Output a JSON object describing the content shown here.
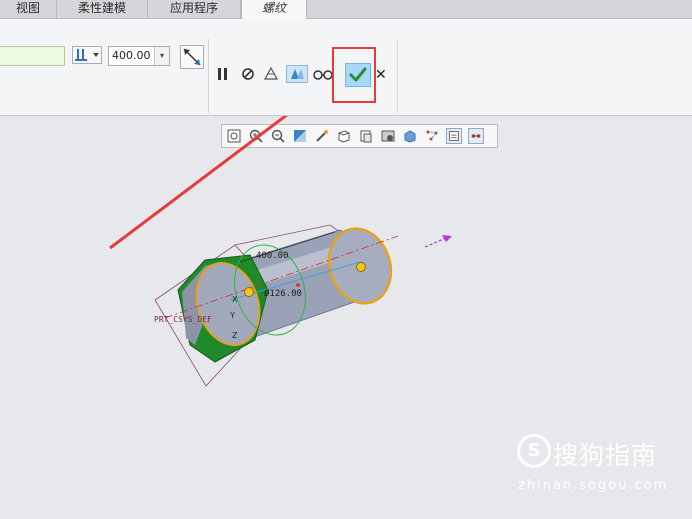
{
  "tabs": [
    {
      "label": "视图"
    },
    {
      "label": "柔性建模"
    },
    {
      "label": "应用程序"
    },
    {
      "label": "螺纹",
      "active": true
    }
  ],
  "ribbon": {
    "depth_value": "400.00",
    "depth_options_arrow": "▾",
    "tools": {
      "pause": "pause-icon",
      "no_preview": "no-preview-icon",
      "preview": "preview-icon",
      "verify": "verify-icon",
      "glasses": "glasses-icon"
    },
    "ok": "check-icon",
    "cancel": "✕"
  },
  "model": {
    "dim_length": "400.00",
    "dim_diameter": "Ø126.00",
    "csys_label": "PRT_CSYS_DEF",
    "axis_x": "X",
    "axis_y": "Y",
    "axis_z": "Z"
  },
  "watermark": {
    "brand": "搜狗指南",
    "url": "zhinan.sogou.com",
    "logo_letter": "S"
  },
  "colors": {
    "highlight_red": "#e8393b",
    "ok_blue": "#a6d9f7",
    "check_green": "#2a8a3a",
    "cylinder": "#9aa2b8",
    "hex_face": "#1e8a2a",
    "edge_orange": "#e6a21a"
  }
}
